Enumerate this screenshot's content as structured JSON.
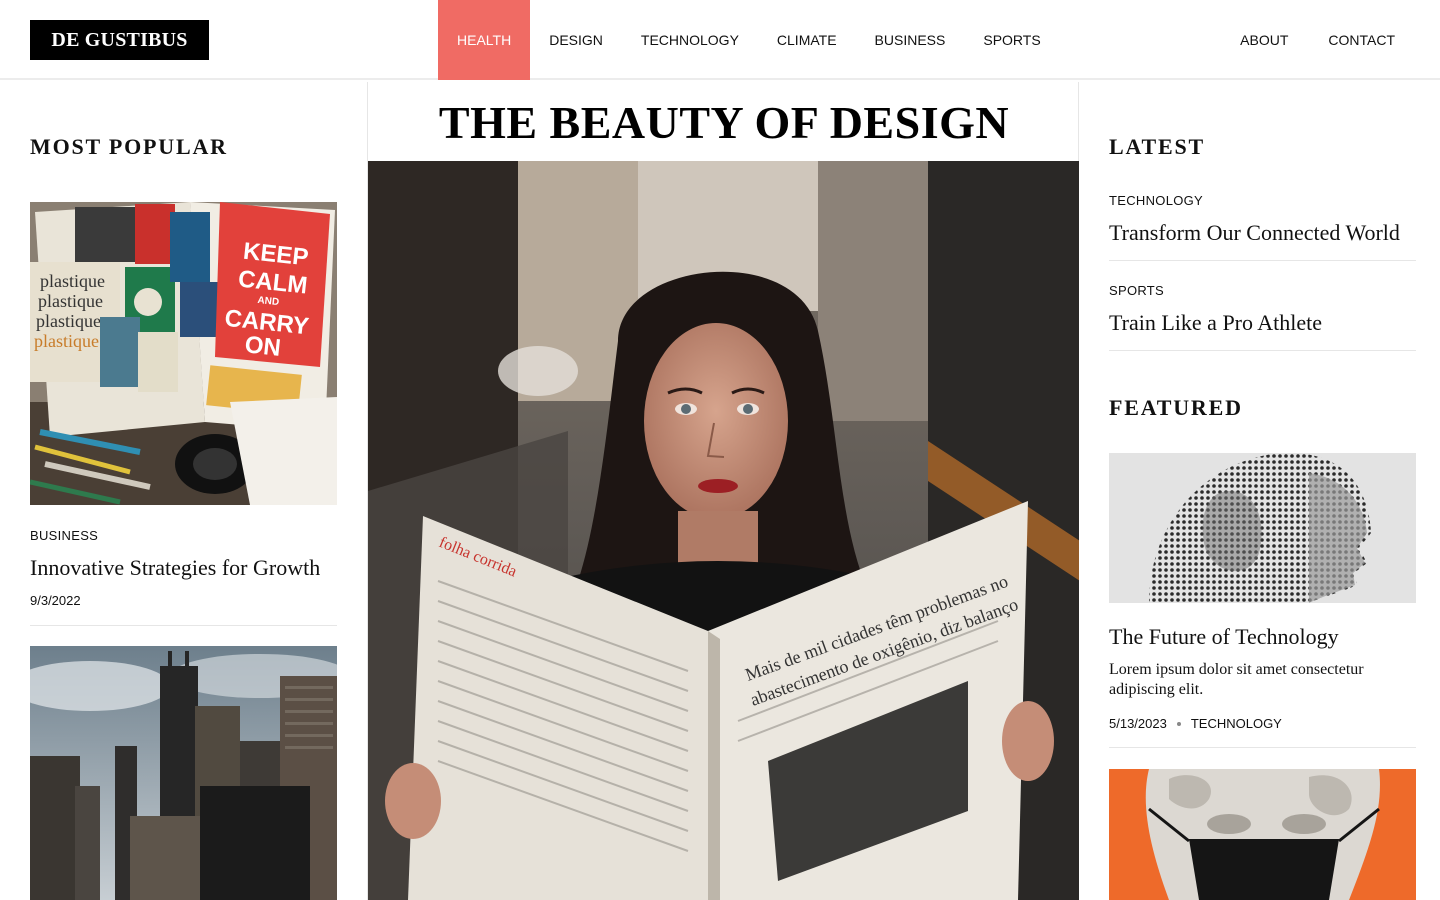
{
  "header": {
    "logo": "DE GUSTIBUS",
    "nav": [
      "HEALTH",
      "DESIGN",
      "TECHNOLOGY",
      "CLIMATE",
      "BUSINESS",
      "SPORTS"
    ],
    "active_nav": "HEALTH",
    "nav_right": [
      "ABOUT",
      "CONTACT"
    ]
  },
  "left": {
    "section_title": "MOST POPULAR",
    "articles": [
      {
        "category": "BUSINESS",
        "title": "Innovative Strategies for Growth",
        "date": "9/3/2022"
      }
    ]
  },
  "main": {
    "hero_title": "THE BEAUTY OF DESIGN"
  },
  "right": {
    "latest_title": "LATEST",
    "latest": [
      {
        "category": "TECHNOLOGY",
        "title": "Transform Our Connected World"
      },
      {
        "category": "SPORTS",
        "title": "Train Like a Pro Athlete"
      }
    ],
    "featured_title": "FEATURED",
    "featured": {
      "title": "The Future of Technology",
      "description": "Lorem ipsum dolor sit amet consectetur adipiscing elit.",
      "date": "5/13/2023",
      "category": "TECHNOLOGY"
    }
  },
  "colors": {
    "accent": "#f06b64",
    "logo_bg": "#000000",
    "divider": "#e6e6e6",
    "featured_orange": "#ee6a2a"
  }
}
